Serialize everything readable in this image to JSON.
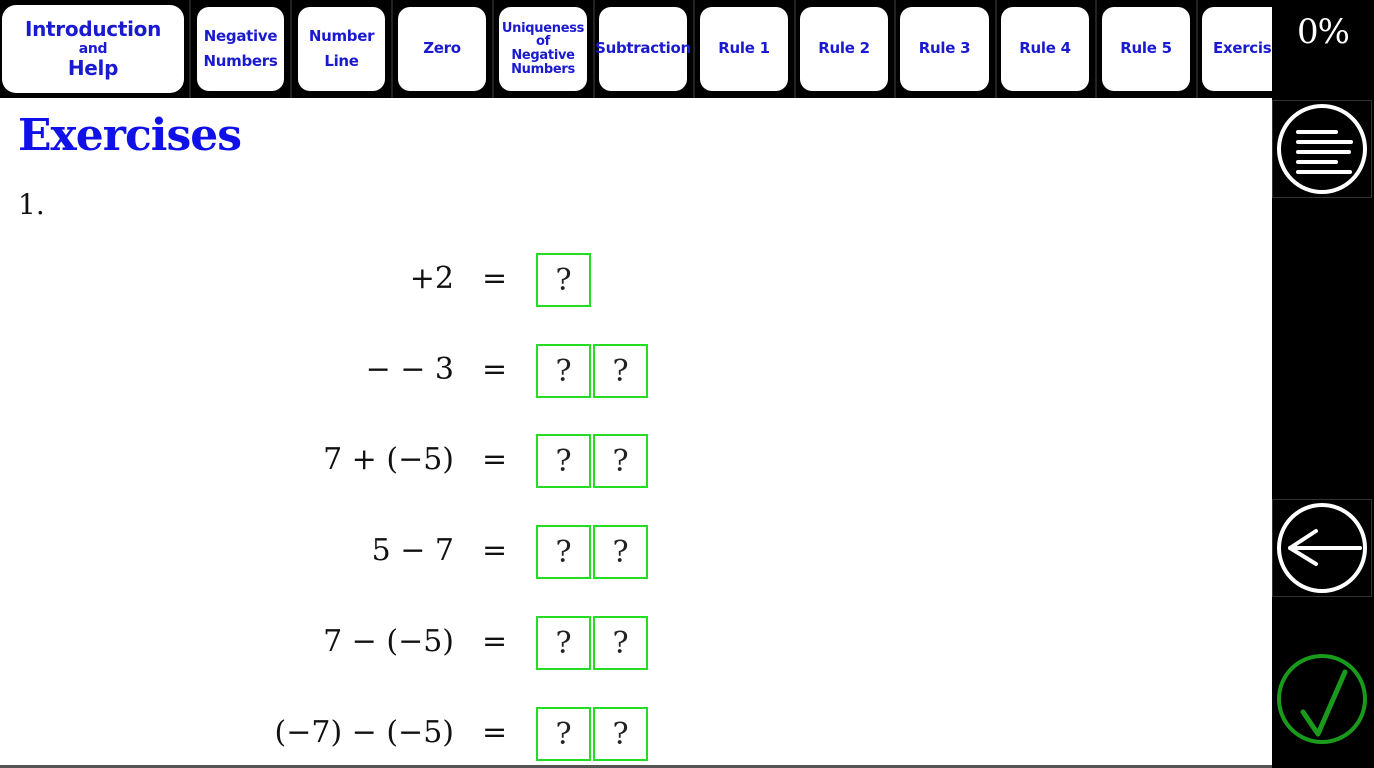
{
  "nav": {
    "tabs": [
      {
        "id": "intro",
        "line1": "Introduction",
        "line2": "and",
        "line3": "Help"
      },
      {
        "id": "negative-numbers",
        "line1": "Negative",
        "line2": "Numbers"
      },
      {
        "id": "number-line",
        "line1": "Number",
        "line2": "Line"
      },
      {
        "id": "zero",
        "line1": "Zero"
      },
      {
        "id": "uniqueness",
        "line1": "Uniqueness",
        "line2": "of",
        "line3": "Negative",
        "line4": "Numbers"
      },
      {
        "id": "subtraction",
        "line1": "Subtraction"
      },
      {
        "id": "rule-1",
        "line1": "Rule 1"
      },
      {
        "id": "rule-2",
        "line1": "Rule 2"
      },
      {
        "id": "rule-3",
        "line1": "Rule 3"
      },
      {
        "id": "rule-4",
        "line1": "Rule 4"
      },
      {
        "id": "rule-5",
        "line1": "Rule 5"
      },
      {
        "id": "exercises",
        "line1": "Exercise"
      }
    ]
  },
  "side": {
    "progress": "0%",
    "menu_icon": "menu-lines-icon",
    "back_icon": "arrow-left-icon",
    "check_icon": "checkmark-icon",
    "check_color": "#1a9a1a"
  },
  "main": {
    "title": "Exercises",
    "question_number": "1.",
    "equals": "=",
    "placeholder": "?",
    "box_color": "#22dd22",
    "equations": [
      {
        "lhs": "+2",
        "boxes": 1
      },
      {
        "lhs": "− − 3",
        "boxes": 2
      },
      {
        "lhs": "7 + (−5)",
        "boxes": 2
      },
      {
        "lhs": "5 − 7",
        "boxes": 2
      },
      {
        "lhs": "7 − (−5)",
        "boxes": 2
      },
      {
        "lhs": "(−7) − (−5)",
        "boxes": 2
      }
    ]
  }
}
